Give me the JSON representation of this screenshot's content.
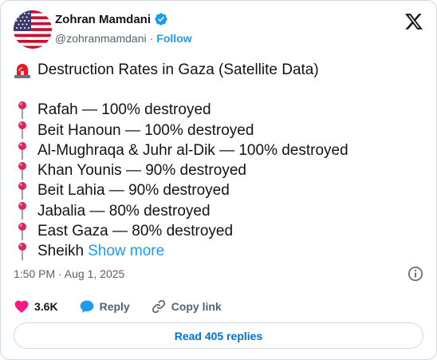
{
  "author": {
    "display_name": "Zohran Mamdani",
    "handle": "@zohranmamdani",
    "separator": "·",
    "follow_label": "Follow"
  },
  "tweet": {
    "headline": "Destruction Rates in Gaza (Satellite Data)",
    "items": [
      "Rafah — 100% destroyed",
      "Beit Hanoun — 100% destroyed",
      "Al-Mughraqa & Juhr al-Dik — 100% destroyed",
      "Khan Younis — 90% destroyed",
      "Beit Lahia — 90% destroyed",
      "Jabalia — 80% destroyed",
      "East Gaza — 80% destroyed",
      "Sheikh"
    ],
    "show_more_label": "Show more",
    "timestamp": "1:50 PM · Aug 1, 2025"
  },
  "actions": {
    "likes": "3.6K",
    "reply_label": "Reply",
    "copy_link_label": "Copy link"
  },
  "read_replies_label": "Read 405 replies",
  "colors": {
    "accent": "#1d9bf0",
    "like": "#f91880",
    "text_secondary": "#536471",
    "border": "#cfd9de"
  },
  "icons": [
    "us-flag-avatar",
    "verified-badge-icon",
    "x-logo-icon",
    "siren-icon",
    "round-pushpin-icon",
    "info-icon",
    "heart-icon",
    "reply-bubble-icon",
    "link-icon"
  ]
}
